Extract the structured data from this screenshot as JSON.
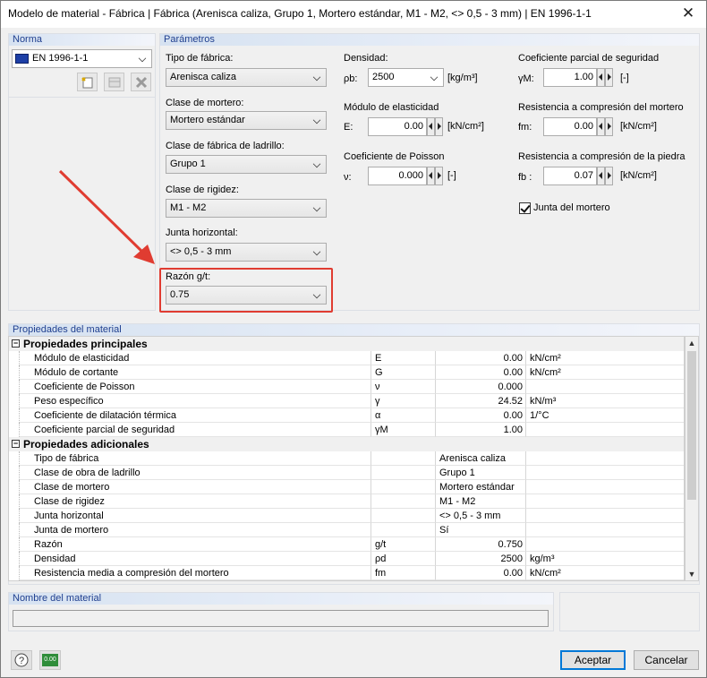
{
  "window": {
    "title": "Modelo de material - Fábrica | Fábrica (Arenisca caliza, Grupo 1, Mortero estándar, M1 - M2, <> 0,5 - 3 mm) | EN 1996-1-1",
    "close": "✕"
  },
  "norma": {
    "header": "Norma",
    "value": "EN 1996-1-1"
  },
  "parametros": {
    "header": "Parámetros",
    "tipo_fabrica": {
      "label": "Tipo de fábrica:",
      "value": "Arenisca caliza"
    },
    "clase_mortero": {
      "label": "Clase de mortero:",
      "value": "Mortero estándar"
    },
    "clase_ladrillo": {
      "label": "Clase de fábrica de ladrillo:",
      "value": "Grupo 1"
    },
    "clase_rigidez": {
      "label": "Clase de rigidez:",
      "value": "M1 - M2"
    },
    "junta_horizontal": {
      "label": "Junta horizontal:",
      "value": "<> 0,5 - 3 mm"
    },
    "razon": {
      "label": "Razón g/t:",
      "value": "0.75"
    },
    "densidad": {
      "label": "Densidad:",
      "sym": "ρb:",
      "value": "2500",
      "unit": "[kg/m³]"
    },
    "modulo": {
      "label": "Módulo de elasticidad",
      "sym": "E:",
      "value": "0.00",
      "unit": "[kN/cm²]"
    },
    "poisson": {
      "label": "Coeficiente de Poisson",
      "sym": "ν:",
      "value": "0.000",
      "unit": "[-]"
    },
    "coef_seg": {
      "label": "Coeficiente parcial de seguridad",
      "sym": "γM:",
      "value": "1.00",
      "unit": "[-]"
    },
    "res_mortero": {
      "label": "Resistencia a compresión del mortero",
      "sym": "fm:",
      "value": "0.00",
      "unit": "[kN/cm²]"
    },
    "res_piedra": {
      "label": "Resistencia a compresión de la piedra",
      "sym": "fb :",
      "value": "0.07",
      "unit": "[kN/cm²]"
    },
    "junta_mortero": {
      "label": "Junta del mortero",
      "checked": true
    }
  },
  "propiedades": {
    "header": "Propiedades del material",
    "sec1": "Propiedades principales",
    "rows1": [
      {
        "name": "Módulo de elasticidad",
        "sym": "E",
        "val": "0.00",
        "unit": "kN/cm²"
      },
      {
        "name": "Módulo de cortante",
        "sym": "G",
        "val": "0.00",
        "unit": "kN/cm²"
      },
      {
        "name": "Coeficiente de Poisson",
        "sym": "ν",
        "val": "0.000",
        "unit": ""
      },
      {
        "name": "Peso específico",
        "sym": "γ",
        "val": "24.52",
        "unit": "kN/m³"
      },
      {
        "name": "Coeficiente de dilatación térmica",
        "sym": "α",
        "val": "0.00",
        "unit": "1/°C"
      },
      {
        "name": "Coeficiente parcial de seguridad",
        "sym": "γM",
        "val": "1.00",
        "unit": ""
      }
    ],
    "sec2": "Propiedades adicionales",
    "rows2": [
      {
        "name": "Tipo de fábrica",
        "sym": "",
        "val": "Arenisca caliza",
        "unit": "",
        "left": true
      },
      {
        "name": "Clase de obra de ladrillo",
        "sym": "",
        "val": "Grupo 1",
        "unit": "",
        "left": true
      },
      {
        "name": "Clase de mortero",
        "sym": "",
        "val": "Mortero estándar",
        "unit": "",
        "left": true
      },
      {
        "name": "Clase de rigidez",
        "sym": "",
        "val": "M1 - M2",
        "unit": "",
        "left": true
      },
      {
        "name": "Junta horizontal",
        "sym": "",
        "val": "<> 0,5 - 3 mm",
        "unit": "",
        "left": true
      },
      {
        "name": "Junta de mortero",
        "sym": "",
        "val": "Sí",
        "unit": "",
        "left": true
      },
      {
        "name": "Razón",
        "sym": "g/t",
        "val": "0.750",
        "unit": ""
      },
      {
        "name": "Densidad",
        "sym": "ρd",
        "val": "2500",
        "unit": "kg/m³"
      },
      {
        "name": "Resistencia media a compresión del mortero",
        "sym": "fm",
        "val": "0.00",
        "unit": "kN/cm²"
      }
    ]
  },
  "nombre": {
    "header": "Nombre del material",
    "value": ""
  },
  "footer": {
    "aceptar": "Aceptar",
    "cancelar": "Cancelar",
    "calc_icon_text": "0.00"
  },
  "annotation": {
    "color": "#e03c31"
  }
}
